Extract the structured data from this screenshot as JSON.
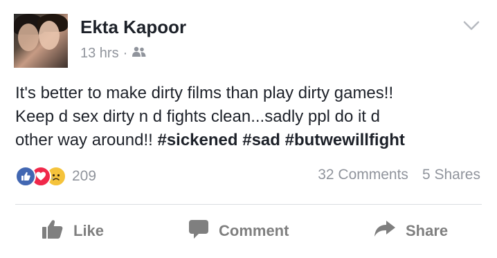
{
  "post": {
    "author": "Ekta Kapoor",
    "time": "13 hrs",
    "separator": "·",
    "audience_icon": "friends-icon",
    "menu_icon": "chevron-down-icon",
    "text_lines": [
      "It's better to make dirty films than play dirty games!!",
      "Keep d sex dirty n d fights clean...sadly ppl do it d",
      "other way around!!"
    ],
    "hashtags": [
      "#sickened",
      "#sad",
      "#butwewillfight"
    ],
    "reactions": {
      "icons": [
        "like-reaction-icon",
        "love-reaction-icon",
        "sad-reaction-icon"
      ],
      "count": "209"
    },
    "comments": "32 Comments",
    "shares": "5 Shares"
  },
  "actions": {
    "like": "Like",
    "comment": "Comment",
    "share": "Share"
  },
  "colors": {
    "like_blue": "#4267b2",
    "love_red": "#f0284a",
    "sad_yellow": "#f5c33b",
    "meta_gray": "#90949c",
    "action_gray": "#7f7f7f"
  }
}
